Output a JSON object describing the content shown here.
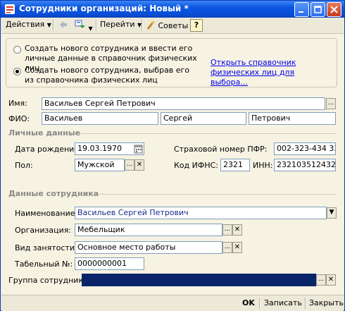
{
  "window": {
    "title": "Сотрудники организаций: Новый *"
  },
  "toolbar": {
    "actions": "Действия",
    "goto": "Перейти",
    "tips": "Советы",
    "help": "?"
  },
  "mode": {
    "option_new": "Создать нового сотрудника и ввести его личные данные в справочник физических лиц",
    "option_select": "Создать нового сотрудника, выбрав его из справочника физических лиц",
    "selected": "option_select",
    "open_link": "Открыть справочник физических лиц для выбора..."
  },
  "form": {
    "name_label": "Имя:",
    "name_value": "Васильев Сергей Петрович",
    "fio_label": "ФИО:",
    "last_name": "Васильев",
    "first_name": "Сергей",
    "middle_name": "Петрович"
  },
  "personal": {
    "section_title": "Личные данные",
    "birthdate_label": "Дата рождения:",
    "birthdate_value": "19.03.1970",
    "pfr_label": "Страховой номер ПФР:",
    "pfr_value": "002-323-434 33",
    "gender_label": "Пол:",
    "gender_value": "Мужской",
    "ifns_label": "Код ИФНС:",
    "ifns_value": "2321",
    "inn_label": "ИНН:",
    "inn_value": "232103512432"
  },
  "employee": {
    "section_title": "Данные сотрудника",
    "name_label": "Наименование:",
    "name_value": "Васильев Сергей Петрович",
    "org_label": "Организация:",
    "org_value": "Мебельщик",
    "emp_type_label": "Вид занятости:",
    "emp_type_value": "Основное место работы",
    "tab_label": "Табельный №:",
    "tab_value": "0000000001",
    "group_label": "Группа сотрудника:",
    "group_value": ""
  },
  "footer": {
    "ok": "OK",
    "save": "Записать",
    "close": "Закрыть"
  }
}
